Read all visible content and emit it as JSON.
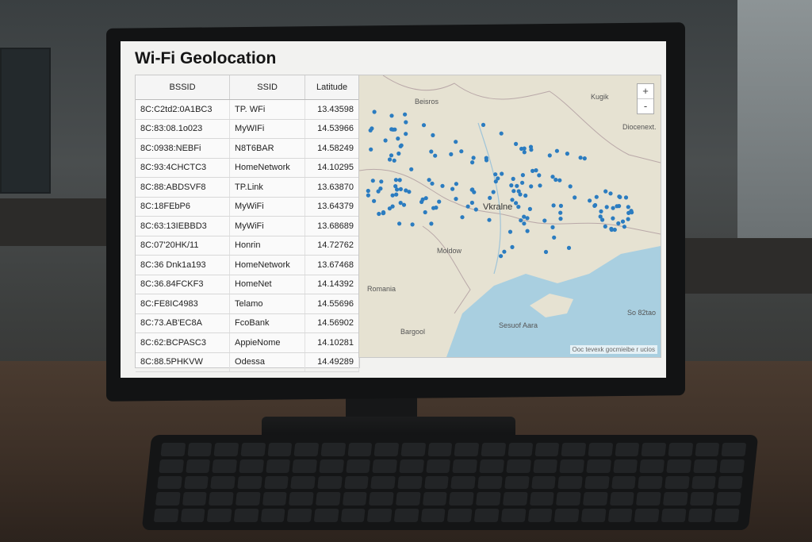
{
  "app": {
    "title": "Wi-Fi Geolocation"
  },
  "table": {
    "columns": [
      "BSSID",
      "SSID",
      "Latitude"
    ],
    "rows": [
      [
        "8C:C2td2:0A1BC3",
        "TP. WFi",
        "13.43598"
      ],
      [
        "8C:83:08.1o023",
        "MyWIFi",
        "14.53966"
      ],
      [
        "8C:0938:NEBFi",
        "N8T6BAR",
        "14.58249"
      ],
      [
        "8C:93:4CHCTC3",
        "HomeNetwork",
        "14.10295"
      ],
      [
        "8C:88:ABDSVF8",
        "TP.Link",
        "13.63870"
      ],
      [
        "8C:18FEbP6",
        "MyWiFi",
        "13.64379"
      ],
      [
        "8C:63:13IEBBD3",
        "MyWiFi",
        "13.68689"
      ],
      [
        "8C:07'20HK/11",
        "Honrin",
        "14.72762"
      ],
      [
        "8C:36 Dnk1a193",
        "HomeNetwork",
        "13.67468"
      ],
      [
        "8C:36.84FCKF3",
        "HomeNet",
        "14.14392"
      ],
      [
        "8C:FE8IC4983",
        "Telamo",
        "14.55696"
      ],
      [
        "8C:73.AB'EC8A",
        "FcoBank",
        "14.56902"
      ],
      [
        "8C:62:BCPASC3",
        "AppieNome",
        "14.10281"
      ],
      [
        "8C:88.5PHKVW",
        "Odessa",
        "14.49289"
      ]
    ]
  },
  "map": {
    "labels": {
      "nw": "Beisros",
      "ne": "Kugik",
      "east": "Diocenext.",
      "center": "Vkralne",
      "moldova": "Moldow",
      "romania": "Romania",
      "south": "Sesuof Aara",
      "sw": "Bargool",
      "se": "So 82tao"
    },
    "zoom_in": "+",
    "zoom_out": "-",
    "attribution": "Ooc tevexk gocmieibe r ucios",
    "dot_color": "#2b7cc0",
    "sea_color": "#a9cfe0"
  }
}
